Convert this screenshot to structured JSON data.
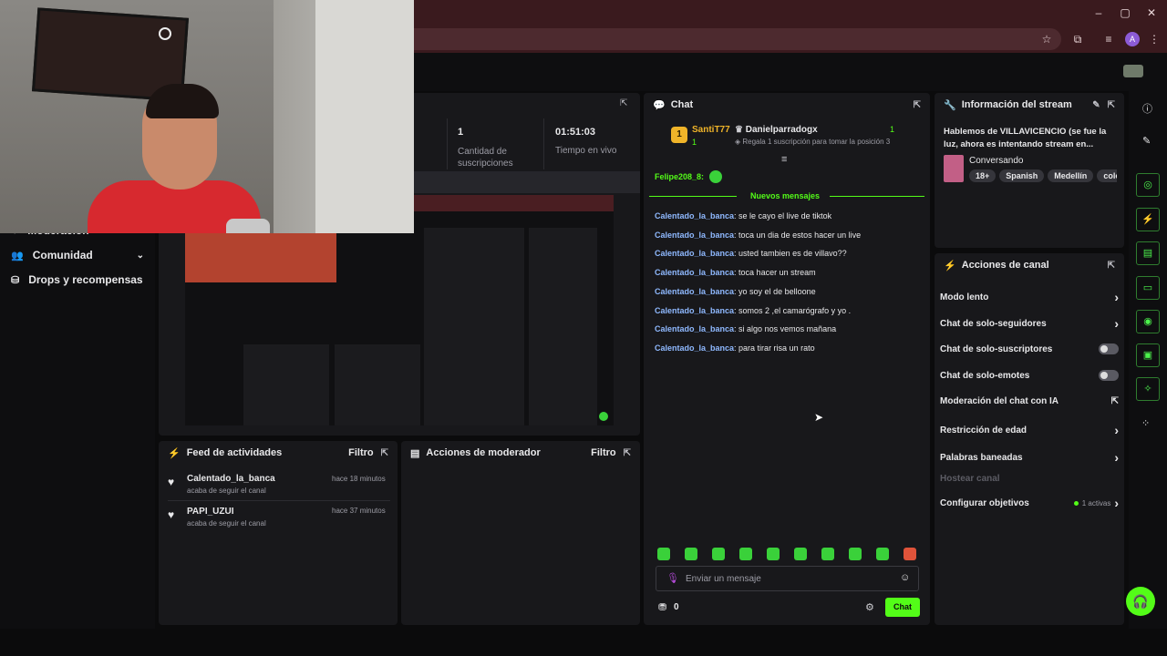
{
  "browser": {
    "window_controls": [
      "–",
      "▢",
      "✕"
    ],
    "profile_initial": "A"
  },
  "sidebar": {
    "items": [
      {
        "label": "Moderación",
        "icon": "shield-icon"
      },
      {
        "label": "Comunidad",
        "icon": "community-icon"
      },
      {
        "label": "Drops y recompensas",
        "icon": "drops-icon"
      }
    ]
  },
  "stats": {
    "subs_value": "1",
    "subs_label": "Cantidad de suscripciones",
    "live_value": "01:51:03",
    "live_label": "Tiempo en vivo"
  },
  "chat": {
    "title": "Chat",
    "leader1": {
      "name": "SantiT77",
      "rank": "1",
      "count": "1"
    },
    "leader2": {
      "name": "Danielparradogx",
      "count": "1",
      "cta": "Regala 1 suscripción para tomar la posición 3"
    },
    "pinned_user": "Felipe208_8:",
    "new_messages_label": "Nuevos mensajes",
    "messages": [
      {
        "user": "Calentado_la_banca",
        "text": ": se le cayo el live de tiktok"
      },
      {
        "user": "Calentado_la_banca",
        "text": ": toca un dia de estos hacer un live"
      },
      {
        "user": "Calentado_la_banca",
        "text": ": usted tambien es de villavo??"
      },
      {
        "user": "Calentado_la_banca",
        "text": ": toca hacer un stream"
      },
      {
        "user": "Calentado_la_banca",
        "text": ": yo soy el de belloone"
      },
      {
        "user": "Calentado_la_banca",
        "text": ": somos 2 ,el camarógrafo y yo ."
      },
      {
        "user": "Calentado_la_banca",
        "text": ": si algo nos vemos mañana"
      },
      {
        "user": "Calentado_la_banca",
        "text": ": para tirar risa un rato"
      }
    ],
    "input_placeholder": "Enviar un mensaje",
    "points": "0",
    "send_label": "Chat"
  },
  "stream_info": {
    "title": "Información del stream",
    "stream_title": "Hablemos de VILLAVICENCIO (se fue la luz, ahora es intentando stream en...",
    "category": "Conversando",
    "tags": [
      "18+",
      "Spanish",
      "Medellín",
      "colo"
    ]
  },
  "channel_actions": {
    "title": "Acciones de canal",
    "items": [
      {
        "label": "Modo lento",
        "control": "chevron"
      },
      {
        "label": "Chat de solo-seguidores",
        "control": "chevron"
      },
      {
        "label": "Chat de solo-suscriptores",
        "control": "toggle"
      },
      {
        "label": "Chat de solo-emotes",
        "control": "toggle"
      },
      {
        "label": "Moderación del chat con IA",
        "control": "external"
      },
      {
        "label": "Restricción de edad",
        "control": "chevron"
      },
      {
        "label": "Palabras baneadas",
        "control": "chevron"
      },
      {
        "label": "Hostear canal",
        "control": "none"
      },
      {
        "label": "Configurar objetivos",
        "control": "chevron",
        "badge": "1 activas"
      }
    ]
  },
  "activity_feed": {
    "title": "Feed de actividades",
    "filter_label": "Filtro",
    "events": [
      {
        "user": "Calentado_la_banca",
        "action": "acaba de seguir el canal",
        "time": "hace 18 minutos"
      },
      {
        "user": "PAPI_UZUI",
        "action": "acaba de seguir el canal",
        "time": "hace 37 minutos"
      }
    ]
  },
  "mod_actions": {
    "title": "Acciones de moderador",
    "filter_label": "Filtro"
  },
  "colors": {
    "accent_green": "#53fc18",
    "panel": "#18181b",
    "background": "#0b0b0c",
    "chrome": "#3a1a1e",
    "username_blue": "#8fb9ff",
    "gold": "#f0b429"
  }
}
